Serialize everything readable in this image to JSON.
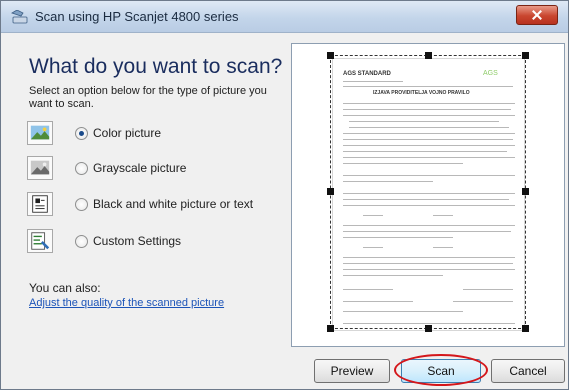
{
  "window": {
    "title": "Scan using HP Scanjet 4800 series",
    "close_icon": "close-icon"
  },
  "main": {
    "heading": "What do you want to scan?",
    "instructions": "Select an option below for the type of picture you want to scan.",
    "options": [
      {
        "label": "Color picture",
        "icon": "color-picture-icon",
        "selected": true
      },
      {
        "label": "Grayscale picture",
        "icon": "grayscale-picture-icon",
        "selected": false
      },
      {
        "label": "Black and white picture or text",
        "icon": "bw-picture-icon",
        "selected": false
      },
      {
        "label": "Custom Settings",
        "icon": "custom-settings-icon",
        "selected": false
      }
    ],
    "you_can_also": "You can also:",
    "adjust_link": "Adjust the quality of the scanned picture"
  },
  "preview": {
    "doc_title": "AGS STANDARD",
    "doc_subtitle": "IZJAVA PROVIDITELJA VOJNO PRAVILO",
    "doc_logo": "AGS"
  },
  "buttons": {
    "preview": "Preview",
    "scan": "Scan",
    "cancel": "Cancel"
  },
  "colors": {
    "heading": "#1a2d5e",
    "link": "#1c54b8",
    "highlight": "#d4161a"
  }
}
